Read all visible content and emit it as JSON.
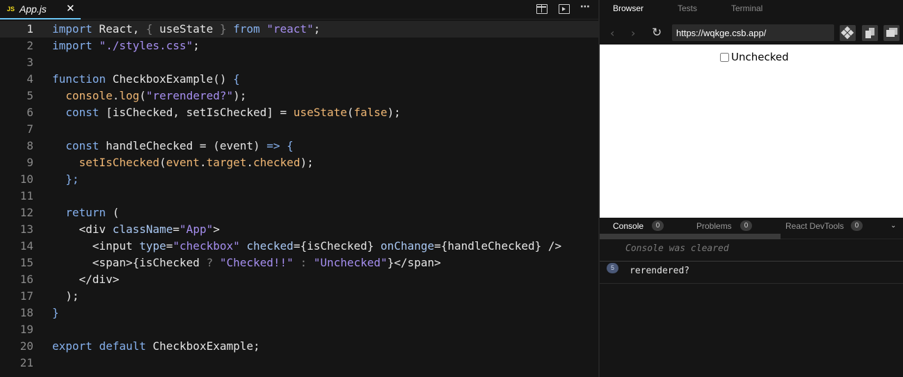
{
  "editor": {
    "file_badge": "JS",
    "file_name": "App.js",
    "close_glyph": "✕",
    "toolbar_icons": [
      "split-view-icon",
      "preview-icon",
      "more-icon"
    ],
    "more_glyph": "⋯",
    "active_line": 1,
    "lines": [
      [
        [
          "kw",
          "import"
        ],
        [
          "var",
          " React, "
        ],
        [
          "dim",
          "{"
        ],
        [
          "var",
          " useState "
        ],
        [
          "dim",
          "}"
        ],
        [
          "kw",
          " from "
        ],
        [
          "str",
          "\"react\""
        ],
        [
          "var",
          ";"
        ]
      ],
      [
        [
          "kw",
          "import"
        ],
        [
          "var",
          " "
        ],
        [
          "str",
          "\"./styles.css\""
        ],
        [
          "var",
          ";"
        ]
      ],
      [],
      [
        [
          "kw",
          "function"
        ],
        [
          "var",
          " CheckboxExample() "
        ],
        [
          "kw",
          "{"
        ]
      ],
      [
        [
          "var",
          "  "
        ],
        [
          "fn",
          "console"
        ],
        [
          "var",
          "."
        ],
        [
          "fn",
          "log"
        ],
        [
          "var",
          "("
        ],
        [
          "str",
          "\"rerendered?\""
        ],
        [
          "var",
          ");"
        ]
      ],
      [
        [
          "var",
          "  "
        ],
        [
          "kw",
          "const"
        ],
        [
          "var",
          " [isChecked, setIsChecked] = "
        ],
        [
          "fn",
          "useState"
        ],
        [
          "var",
          "("
        ],
        [
          "fn",
          "false"
        ],
        [
          "var",
          ");"
        ]
      ],
      [],
      [
        [
          "var",
          "  "
        ],
        [
          "kw",
          "const"
        ],
        [
          "var",
          " handleChecked = (event) "
        ],
        [
          "kw",
          "=>"
        ],
        [
          "var",
          " "
        ],
        [
          "kw",
          "{"
        ]
      ],
      [
        [
          "var",
          "    "
        ],
        [
          "fn",
          "setIsChecked"
        ],
        [
          "var",
          "("
        ],
        [
          "fn",
          "event"
        ],
        [
          "var",
          "."
        ],
        [
          "fn",
          "target"
        ],
        [
          "var",
          "."
        ],
        [
          "fn",
          "checked"
        ],
        [
          "var",
          ");"
        ]
      ],
      [
        [
          "var",
          "  "
        ],
        [
          "kw",
          "};"
        ]
      ],
      [],
      [
        [
          "var",
          "  "
        ],
        [
          "kw",
          "return"
        ],
        [
          "var",
          " ("
        ]
      ],
      [
        [
          "var",
          "    <div "
        ],
        [
          "attr",
          "className"
        ],
        [
          "var",
          "="
        ],
        [
          "str",
          "\"App\""
        ],
        [
          "var",
          ">"
        ]
      ],
      [
        [
          "var",
          "      <input "
        ],
        [
          "attr",
          "type"
        ],
        [
          "var",
          "="
        ],
        [
          "str",
          "\"checkbox\""
        ],
        [
          "var",
          " "
        ],
        [
          "attr",
          "checked"
        ],
        [
          "var",
          "={isChecked} "
        ],
        [
          "attr",
          "onChange"
        ],
        [
          "var",
          "={handleChecked} />"
        ]
      ],
      [
        [
          "var",
          "      <span>{isChecked "
        ],
        [
          "dim",
          "?"
        ],
        [
          "var",
          " "
        ],
        [
          "str",
          "\"Checked!!\""
        ],
        [
          "var",
          " "
        ],
        [
          "dim",
          ":"
        ],
        [
          "var",
          " "
        ],
        [
          "str",
          "\"Unchecked\""
        ],
        [
          "var",
          "}</span>"
        ]
      ],
      [
        [
          "var",
          "    </div>"
        ]
      ],
      [
        [
          "var",
          "  );"
        ]
      ],
      [
        [
          "kw",
          "}"
        ]
      ],
      [],
      [
        [
          "kw",
          "export"
        ],
        [
          "var",
          " "
        ],
        [
          "kw",
          "default"
        ],
        [
          "var",
          " CheckboxExample;"
        ]
      ],
      []
    ]
  },
  "right_panel": {
    "tabs": [
      "Browser",
      "Tests",
      "Terminal"
    ],
    "selected_tab": "Browser",
    "nav": {
      "back": "‹",
      "forward": "›",
      "refresh": "↻"
    },
    "url": "https://wqkge.csb.app/",
    "preview": {
      "checkbox_checked": false,
      "label": "Unchecked"
    },
    "console_tabs": [
      {
        "label": "Console",
        "count": "0"
      },
      {
        "label": "Problems",
        "count": "0"
      },
      {
        "label": "React DevTools",
        "count": "0"
      }
    ],
    "chevron": "⌄",
    "console_cleared": "Console was cleared",
    "log_entry": {
      "count": "5",
      "message": "rerendered?"
    }
  },
  "colors": {
    "keyword": "#86b1ee",
    "string": "#a68ff0",
    "function": "#f0b774",
    "tab_accent": "#6cc7f6",
    "js_badge": "#f7df1e"
  }
}
